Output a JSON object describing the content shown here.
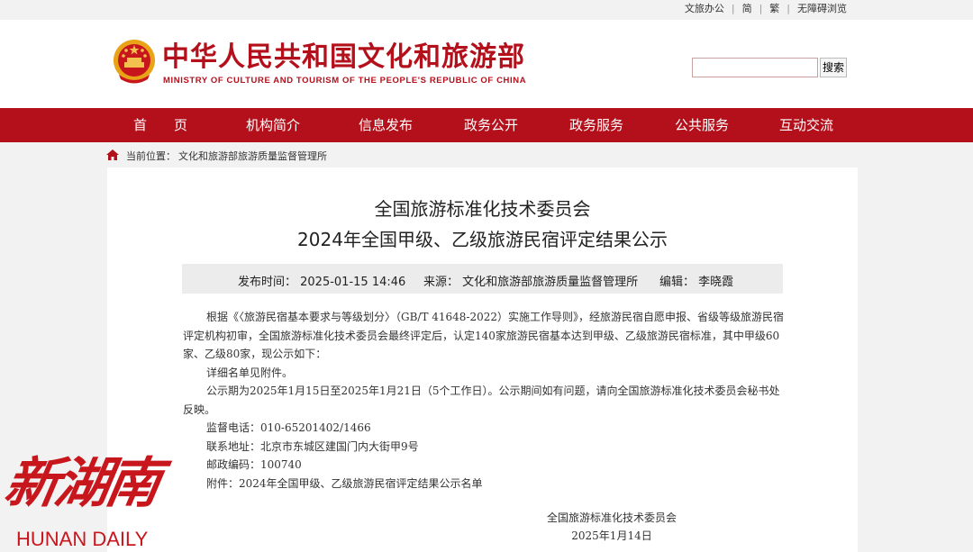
{
  "top_links": [
    "文旅办公",
    "简",
    "繁",
    "无障碍浏览"
  ],
  "header": {
    "logo_cn": "中华人民共和国文化和旅游部",
    "logo_en": "MINISTRY OF CULTURE AND TOURISM OF THE PEOPLE'S REPUBLIC OF CHINA",
    "search_placeholder": "",
    "search_button": "搜索"
  },
  "nav": [
    "首　　页",
    "机构简介",
    "信息发布",
    "政务公开",
    "政务服务",
    "公共服务",
    "互动交流"
  ],
  "breadcrumb": {
    "label": "当前位置：",
    "path": "文化和旅游部旅游质量监督管理所"
  },
  "article": {
    "title_line1": "全国旅游标准化技术委员会",
    "title_line2": "2024年全国甲级、乙级旅游民宿评定结果公示",
    "publish_time": "发布时间：  2025-01-15 14:46",
    "source": "来源：  文化和旅游部旅游质量监督管理所",
    "editor": "编辑：  李晓霞",
    "paragraphs": [
      "根据《〈旅游民宿基本要求与等级划分〉（GB/T  41648-2022）实施工作导则》，经旅游民宿自愿申报、省级等级旅游民宿评定机构初审，全国旅游标准化技术委员会最终评定后，认定140家旅游民宿基本达到甲级、乙级旅游民宿标准，其中甲级60家、乙级80家，现公示如下：",
      "详细名单见附件。",
      "公示期为2025年1月15日至2025年1月21日（5个工作日）。公示期间如有问题，请向全国旅游标准化技术委员会秘书处反映。",
      "监督电话：010-65201402/1466",
      "联系地址：北京市东城区建国门内大街甲9号",
      "邮政编码：100740",
      "附件：2024年全国甲级、乙级旅游民宿评定结果公示名单"
    ],
    "signature": "全国旅游标准化技术委员会",
    "date": "2025年1月14日"
  },
  "watermark": {
    "cn": "新湖南",
    "en": "HUNAN DAILY"
  },
  "colors": {
    "brand_red": "#b3101b",
    "watermark_red": "#c8161d"
  }
}
